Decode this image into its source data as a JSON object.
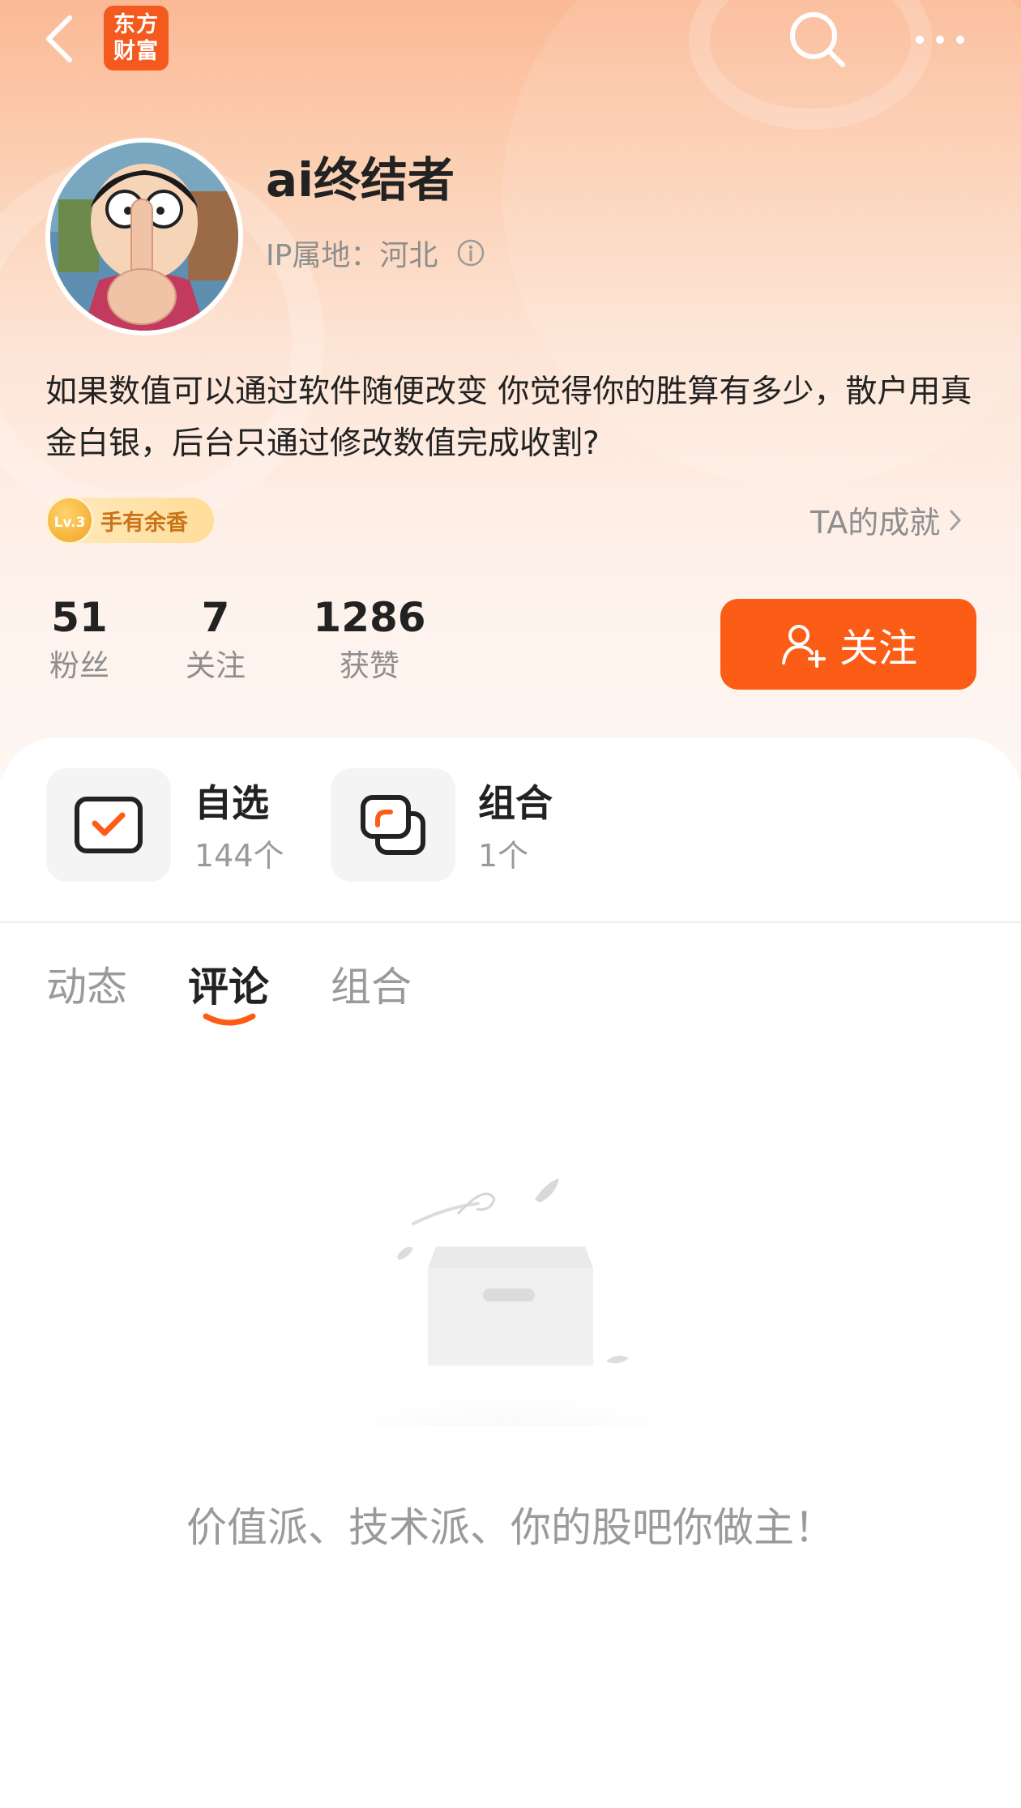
{
  "header": {
    "logo_line1": "东方",
    "logo_line2": "财富",
    "back_icon": "back-arrow-icon",
    "search_icon": "search-icon",
    "more_icon": "more-dots-icon"
  },
  "profile": {
    "username": "ai终结者",
    "ip_location": "IP属地：河北",
    "bio": "如果数值可以通过软件随便改变 你觉得你的胜算有多少，散户用真金白银，后台只通过修改数值完成收割?",
    "badge_level": "Lv.3",
    "badge_text": "手有余香",
    "achievements_label": "TA的成就"
  },
  "stats": [
    {
      "value": "51",
      "label": "粉丝"
    },
    {
      "value": "7",
      "label": "关注"
    },
    {
      "value": "1286",
      "label": "获赞"
    }
  ],
  "follow_button": {
    "label": "关注"
  },
  "shortcuts": [
    {
      "title": "自选",
      "subtitle": "144个",
      "icon": "watchlist-check-icon"
    },
    {
      "title": "组合",
      "subtitle": "1个",
      "icon": "portfolio-icon"
    }
  ],
  "tabs": [
    {
      "label": "动态",
      "active": false
    },
    {
      "label": "评论",
      "active": true
    },
    {
      "label": "组合",
      "active": false
    }
  ],
  "empty_state": {
    "message": "价值派、技术派、你的股吧你做主！",
    "icon": "empty-box-icon"
  },
  "colors": {
    "accent": "#fc5d16",
    "logo": "#f45a1e",
    "muted_text": "#9a9a9a"
  }
}
